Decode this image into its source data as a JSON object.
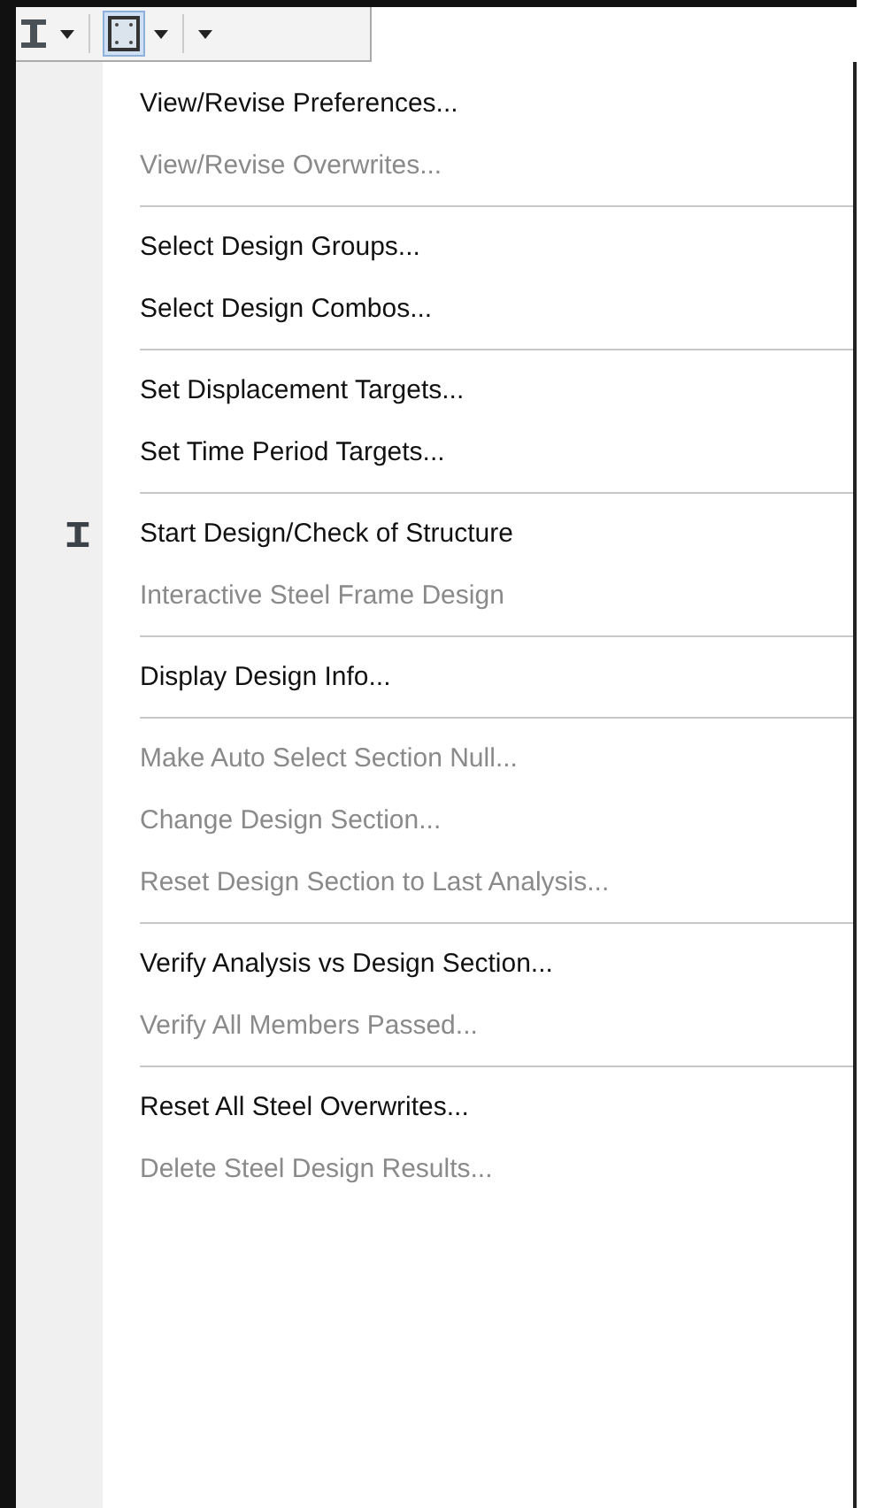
{
  "groups": [
    {
      "items": [
        {
          "label": "View/Revise Preferences...",
          "disabled": false,
          "has_icon": false
        },
        {
          "label": "View/Revise Overwrites...",
          "disabled": true,
          "has_icon": false
        }
      ]
    },
    {
      "items": [
        {
          "label": "Select Design Groups...",
          "disabled": false,
          "has_icon": false
        },
        {
          "label": "Select Design Combos...",
          "disabled": false,
          "has_icon": false
        }
      ]
    },
    {
      "items": [
        {
          "label": "Set Displacement Targets...",
          "disabled": false,
          "has_icon": false
        },
        {
          "label": "Set Time Period Targets...",
          "disabled": false,
          "has_icon": false
        }
      ]
    },
    {
      "items": [
        {
          "label": "Start Design/Check of Structure",
          "disabled": false,
          "has_icon": true
        },
        {
          "label": "Interactive Steel Frame Design",
          "disabled": true,
          "has_icon": false
        }
      ]
    },
    {
      "items": [
        {
          "label": "Display Design Info...",
          "disabled": false,
          "has_icon": false
        }
      ]
    },
    {
      "items": [
        {
          "label": "Make Auto Select Section Null...",
          "disabled": true,
          "has_icon": false
        },
        {
          "label": "Change Design Section...",
          "disabled": true,
          "has_icon": false
        },
        {
          "label": "Reset Design Section to Last Analysis...",
          "disabled": true,
          "has_icon": false
        }
      ]
    },
    {
      "items": [
        {
          "label": "Verify Analysis vs Design Section...",
          "disabled": false,
          "has_icon": false
        },
        {
          "label": "Verify All Members Passed...",
          "disabled": true,
          "has_icon": false
        }
      ]
    },
    {
      "items": [
        {
          "label": "Reset All Steel Overwrites...",
          "disabled": false,
          "has_icon": false
        },
        {
          "label": "Delete Steel Design Results...",
          "disabled": true,
          "has_icon": false
        }
      ]
    }
  ]
}
